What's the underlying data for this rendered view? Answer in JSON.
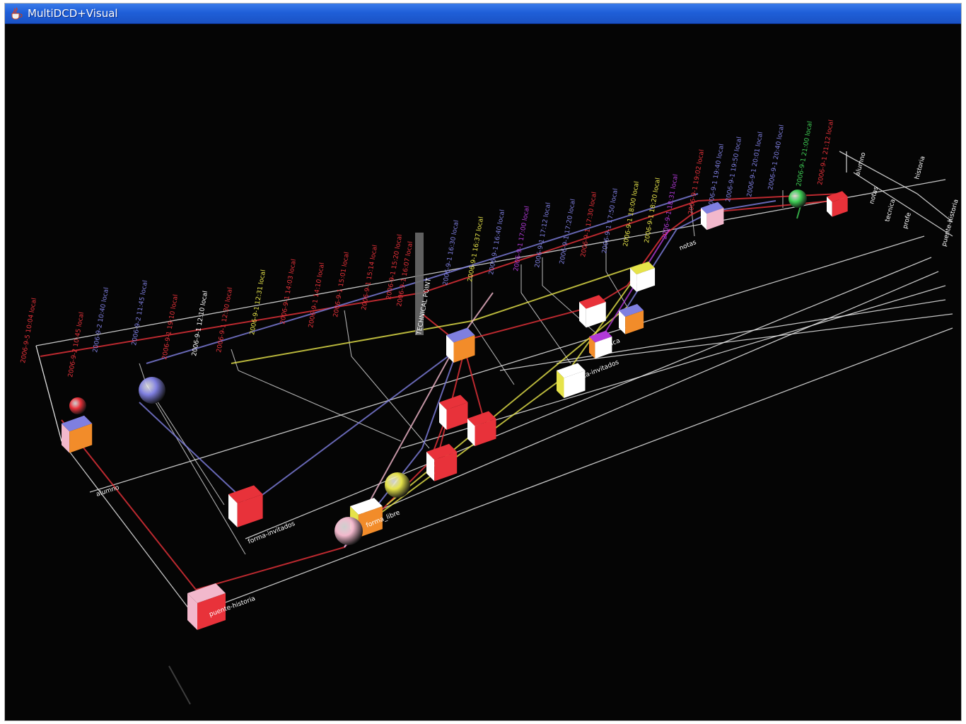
{
  "window": {
    "title": "MultiDCD+Visual",
    "icon": "java-cup-icon"
  },
  "colors": {
    "background": "#050505",
    "grid": "#e6e6e6",
    "red": "#e8323a",
    "blue": "#7f7fe0",
    "yellow": "#e6e34a",
    "pink": "#f2b8cc",
    "green": "#3fcf55",
    "purple": "#b23ad8",
    "orange": "#f28c2a",
    "white": "#ffffff"
  },
  "tracks": [
    {
      "label": "puente-historia"
    },
    {
      "label": "forma-invitados"
    },
    {
      "label": "forma_libre"
    },
    {
      "label": "puerta-invitados"
    },
    {
      "label": "tecnica"
    },
    {
      "label": "notas"
    },
    {
      "label": "alumno"
    }
  ],
  "timeline_labels": [
    {
      "text": "2006-9-5 10:04 local",
      "color": "red"
    },
    {
      "text": "2006-9-2 10:45 local",
      "color": "red"
    },
    {
      "text": "2006-9-2 10:40 local",
      "color": "blue"
    },
    {
      "text": "2006-9-2 11:45 local",
      "color": "blue"
    },
    {
      "text": "2006-9-1 19:10 local",
      "color": "red"
    },
    {
      "text": "2006-9-1 12:10 local",
      "color": "white"
    },
    {
      "text": "2006-9-1 12:30 local",
      "color": "red"
    },
    {
      "text": "2006-9-1 12:31 local",
      "color": "yellow"
    },
    {
      "text": "2006-9-1 14:03 local",
      "color": "red"
    },
    {
      "text": "2006-9-1 14:10 local",
      "color": "red"
    },
    {
      "text": "2006-9-1 15:01 local",
      "color": "red"
    },
    {
      "text": "2006-9-1 15:14 local",
      "color": "red"
    },
    {
      "text": "2006-9-1 15:20 local",
      "color": "red"
    },
    {
      "text": "2006-9-1 16:07 local",
      "color": "red"
    },
    {
      "text": "TECHNICAL POINT",
      "color": "white"
    },
    {
      "text": "2006-9-1 16:30 local",
      "color": "blue"
    },
    {
      "text": "2006-9-1 16:37 local",
      "color": "yellow"
    },
    {
      "text": "2006-9-1 16:40 local",
      "color": "blue"
    },
    {
      "text": "2006-9-1 17:00 local",
      "color": "purple"
    },
    {
      "text": "2006-9-1 17:12 local",
      "color": "blue"
    },
    {
      "text": "2006-9-1 17:20 local",
      "color": "blue"
    },
    {
      "text": "2006-9-1 17:30 local",
      "color": "red"
    },
    {
      "text": "2006-9-1 17:50 local",
      "color": "blue"
    },
    {
      "text": "2006-9-1 18:00 local",
      "color": "yellow"
    },
    {
      "text": "2006-9-1 18:20 local",
      "color": "yellow"
    },
    {
      "text": "2006-9-1 18:31 local",
      "color": "purple"
    },
    {
      "text": "2006-9-1 19:02 local",
      "color": "red"
    },
    {
      "text": "2006-9-1 19:40 local",
      "color": "blue"
    },
    {
      "text": "2006-9-1 19:50 local",
      "color": "blue"
    },
    {
      "text": "2006-9-1 20:01 local",
      "color": "blue"
    },
    {
      "text": "2006-9-1 20:40 local",
      "color": "blue"
    },
    {
      "text": "2006-9-1 21:00 local",
      "color": "green"
    },
    {
      "text": "2006-9-1 21:12 local",
      "color": "red"
    }
  ],
  "header_labels": [
    {
      "text": "alumno"
    },
    {
      "text": "notas"
    },
    {
      "text": "tecnica"
    },
    {
      "text": "profe"
    },
    {
      "text": "historia"
    },
    {
      "text": "puente-historia"
    }
  ]
}
